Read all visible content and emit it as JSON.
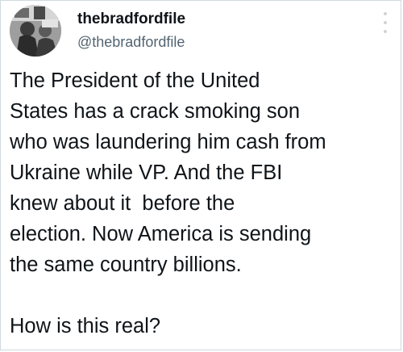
{
  "tweet": {
    "display_name": "thebradfordfile",
    "handle": "@thebradfordfile",
    "avatar_icon": "profile-photo",
    "more_icon": "vertical-ellipsis-icon",
    "body_lines": [
      "The President of the United",
      "States has a crack smoking son",
      "who was laundering him cash from",
      "Ukraine while VP. And the FBI",
      "knew about it  before the",
      "election. Now America is sending",
      "the same country billions."
    ],
    "closing_line": "How is this real?"
  }
}
